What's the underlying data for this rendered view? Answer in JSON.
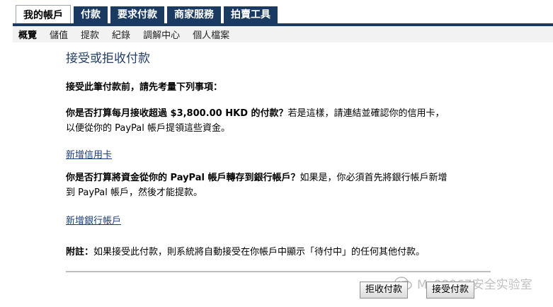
{
  "tabs": [
    "我的帳戶",
    "付款",
    "要求付款",
    "商家服務",
    "拍賣工具"
  ],
  "subnav": [
    "概覽",
    "儲值",
    "提款",
    "紀錄",
    "調解中心",
    "個人檔案"
  ],
  "page": {
    "title": "接受或拒收付款",
    "intro": "接受此筆付款前，請先考量下列事項：",
    "q1_bold": "你是否打算每月接收超過 $3,800.00 HKD 的付款？",
    "q1_rest_line1": "若是這樣，請連結並確認你的信用卡，",
    "q1_line2": "以便從你的 PayPal 帳戶提領這些資金。",
    "link_card": "新增信用卡",
    "q2_bold": "你是否打算將資金從你的 PayPal 帳戶轉存到銀行帳戶？",
    "q2_rest_line1": "如果是，你必須首先將銀行帳戶新增",
    "q2_line2": "到 PayPal 帳戶，然後才能提款。",
    "link_bank": "新增銀行帳戶",
    "note_bold": "附註：",
    "note_text": "如果接受此付款，則系統將自動接受在你帳戶中顯示「待付中」的任何其他付款。"
  },
  "buttons": {
    "reject": "拒收付款",
    "accept": "接受付款"
  },
  "watermark": "Ms08067安全实验室"
}
